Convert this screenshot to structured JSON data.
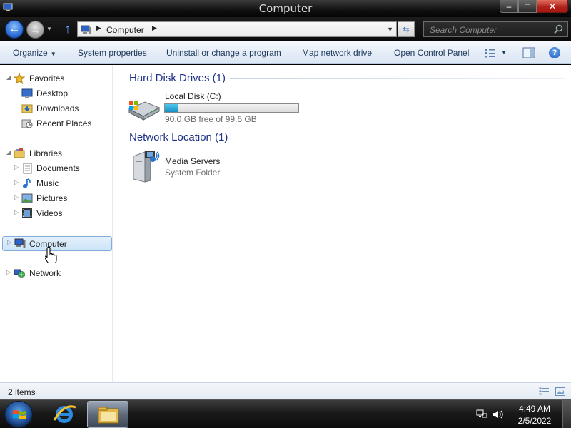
{
  "window": {
    "title": "Computer",
    "caption": {
      "minimize": "–",
      "maximize": "□",
      "close": "✕"
    }
  },
  "navigation": {
    "back": "←",
    "forward": "→",
    "up": "↑",
    "address": {
      "location": "Computer"
    },
    "refresh": "⇆",
    "search": {
      "placeholder": "Search Computer"
    }
  },
  "commands": {
    "organize": "Organize",
    "system_properties": "System properties",
    "uninstall": "Uninstall or change a program",
    "map_drive": "Map network drive",
    "control_panel": "Open Control Panel",
    "help": "?"
  },
  "nav_pane": {
    "favorites": {
      "label": "Favorites",
      "items": [
        "Desktop",
        "Downloads",
        "Recent Places"
      ]
    },
    "libraries": {
      "label": "Libraries",
      "items": [
        "Documents",
        "Music",
        "Pictures",
        "Videos"
      ]
    },
    "computer": "Computer",
    "network": "Network",
    "selected": "Computer"
  },
  "content": {
    "groups": [
      {
        "header": "Hard Disk Drives (1)",
        "items": [
          {
            "name": "Local Disk (C:)",
            "free_text": "90.0 GB free of 99.6 GB",
            "used_fraction": 0.096
          }
        ]
      },
      {
        "header": "Network Location (1)",
        "items": [
          {
            "name": "Media Servers",
            "type": "System Folder"
          }
        ]
      }
    ]
  },
  "statusbar": {
    "item_count": "2 items"
  },
  "taskbar": {
    "clock_time": "4:49 AM",
    "clock_date": "2/5/2022"
  },
  "colors": {
    "group_header": "#1e3287",
    "command_text": "#1e395b",
    "capacity_fill": "#1a8fc4",
    "selection": "#cce4f7"
  }
}
